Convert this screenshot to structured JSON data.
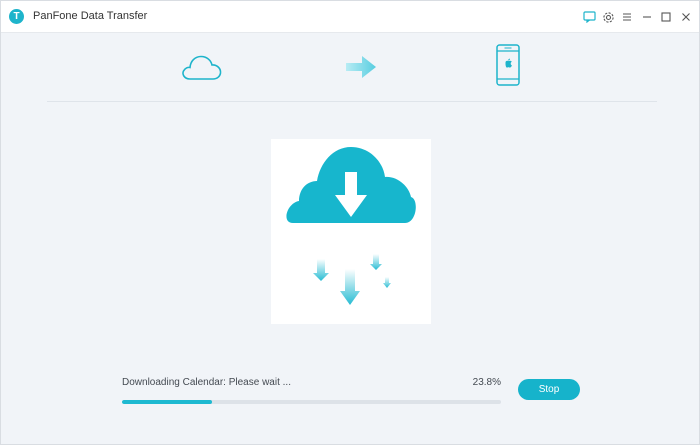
{
  "window": {
    "title": "PanFone Data Transfer",
    "logo_letter": "T"
  },
  "titlebar_icons": [
    "feedback-icon",
    "gear-icon",
    "menu-icon",
    "minimize-icon",
    "maximize-icon",
    "close-icon"
  ],
  "steps": {
    "source_icon": "cloud-icon",
    "arrow_icon": "arrow-right-icon",
    "target_icon": "iphone-icon"
  },
  "progress": {
    "status_text": "Downloading Calendar: Please wait ...",
    "percent_text": "23.8%",
    "value": 0.238
  },
  "actions": {
    "stop_label": "Stop"
  },
  "colors": {
    "accent": "#16b3cb",
    "background": "#f1f4f8"
  }
}
